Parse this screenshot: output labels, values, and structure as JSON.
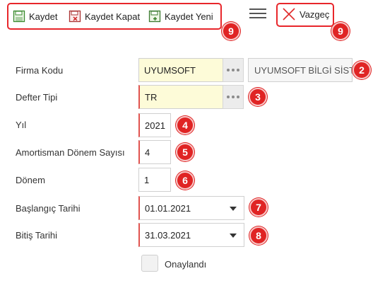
{
  "toolbar": {
    "save_label": "Kaydet",
    "save_close_label": "Kaydet Kapat",
    "save_new_label": "Kaydet Yeni",
    "cancel_label": "Vazgeç"
  },
  "form": {
    "company_code": {
      "label": "Firma Kodu",
      "value": "UYUMSOFT",
      "description": "UYUMSOFT BİLGİ SİSTEMLERİ"
    },
    "ledger_type": {
      "label": "Defter Tipi",
      "value": "TR"
    },
    "year": {
      "label": "Yıl",
      "value": "2021"
    },
    "depreciation_periods": {
      "label": "Amortisman Dönem Sayısı",
      "value": "4"
    },
    "period": {
      "label": "Dönem",
      "value": "1"
    },
    "start_date": {
      "label": "Başlangıç Tarihi",
      "value": "01.01.2021"
    },
    "end_date": {
      "label": "Bitiş Tarihi",
      "value": "31.03.2021"
    },
    "approved": {
      "label": "Onaylandı",
      "checked": false
    }
  },
  "badges": {
    "company_description": "2",
    "ledger_type": "3",
    "year": "4",
    "depreciation_periods": "5",
    "period": "6",
    "start_date": "7",
    "end_date": "8",
    "save_group": "9",
    "cancel_group": "9"
  },
  "colors": {
    "highlight": "#e8262b",
    "badge": "#e02424",
    "required_field": "#fdfbd8"
  }
}
